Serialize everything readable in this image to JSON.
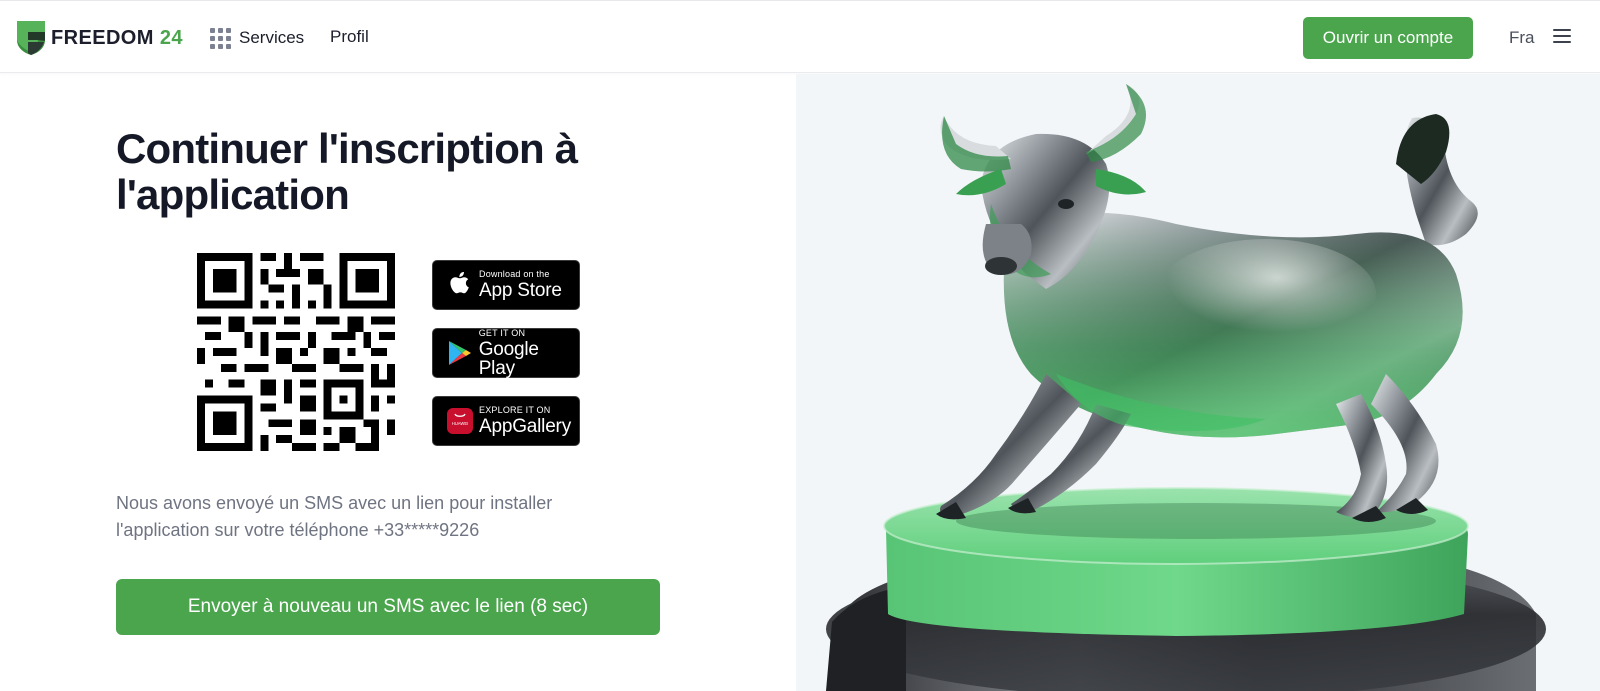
{
  "header": {
    "logo": {
      "word": "FREEDOM",
      "number": "24",
      "icon": "shield-logo-icon"
    },
    "nav": {
      "services_label": "Services",
      "services_icon": "grid-menu-icon",
      "profil_label": "Profil"
    },
    "open_account_label": "Ouvrir un compte",
    "language_label": "Fra",
    "menu_icon": "hamburger-icon"
  },
  "main": {
    "title": "Continuer l'inscription à l'application",
    "qr_icon": "qr-code-icon",
    "stores": {
      "app_store": {
        "small": "Download on the",
        "big": "App Store",
        "icon": "apple-icon"
      },
      "google_play": {
        "small": "GET IT ON",
        "big": "Google Play",
        "icon": "google-play-icon"
      },
      "app_gallery": {
        "small": "EXPLORE IT ON",
        "big": "AppGallery",
        "icon": "huawei-icon",
        "icon_text": "HUAWEI"
      }
    },
    "sms_text": "Nous avons envoyé un SMS avec un lien pour installer l'application sur votre téléphone +33*****9226",
    "resend_label": "Envoyer à nouveau un SMS avec le lien (8 sec)"
  },
  "hero": {
    "image": "silver-bull-on-green-pedestal"
  },
  "colors": {
    "accent": "#4aa54d",
    "text_dark": "#151826",
    "text_muted": "#6f7482",
    "hero_bg": "#f3f6f9"
  }
}
